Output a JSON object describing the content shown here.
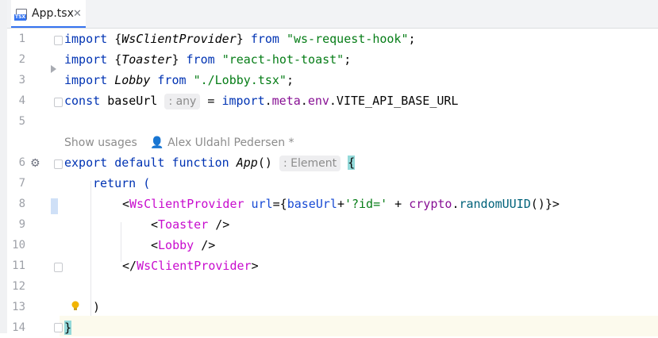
{
  "tab": {
    "label": "App.tsx",
    "icon_label": "TSX",
    "close": "✕"
  },
  "gutter": {
    "line_numbers": [
      "1",
      "2",
      "3",
      "4",
      "5",
      "6",
      "7",
      "8",
      "9",
      "10",
      "11",
      "12",
      "13",
      "14"
    ]
  },
  "code": {
    "l1": {
      "a": "import ",
      "b": "{",
      "c": "WsClientProvider",
      "d": "} ",
      "e": "from ",
      "f": "\"ws-request-hook\"",
      "g": ";"
    },
    "l2": {
      "a": "import ",
      "b": "{",
      "c": "Toaster",
      "d": "} ",
      "e": "from ",
      "f": "\"react-hot-toast\"",
      "g": ";"
    },
    "l3": {
      "a": "import ",
      "c": "Lobby",
      "e": " from ",
      "f": "\"./Lobby.tsx\"",
      "g": ";"
    },
    "l4": {
      "a": "const ",
      "b": "baseUrl",
      "hint": ": any",
      "c": " = ",
      "d": "import",
      "e": ".",
      "f": "meta",
      "g": ".",
      "h": "env",
      "i": ".VITE_API_BASE_URL"
    },
    "l6": {
      "a": "export default function ",
      "b": "App",
      "c": "()",
      "hint": ": Element",
      "d": "{"
    },
    "l7": {
      "a": "return ("
    },
    "l8": {
      "a": "<",
      "b": "WsClientProvider",
      "c": " url",
      "d": "={",
      "e": "baseUrl",
      "f": "+",
      "g": "'?id='",
      "h": " + ",
      "i": "crypto",
      "j": ".",
      "k": "randomUUID",
      "l": "()}>"
    },
    "l9": {
      "a": "<",
      "b": "Toaster",
      "c": " />"
    },
    "l10": {
      "a": "<",
      "b": "Lobby",
      "c": " />"
    },
    "l11": {
      "a": "</",
      "b": "WsClientProvider",
      "c": ">"
    },
    "l13": {
      "a": ")"
    },
    "l14": {
      "a": "}"
    }
  },
  "usages": {
    "show_usages": "Show usages",
    "author": "Alex Uldahl Pedersen *"
  },
  "colors": {
    "keyword": "#0033b3",
    "string": "#067d17",
    "component": "#c80cce",
    "accent": "#3574f0"
  }
}
